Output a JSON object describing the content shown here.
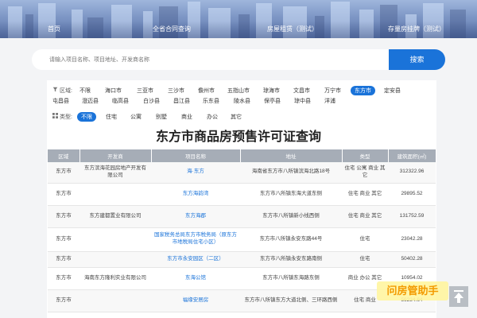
{
  "nav": [
    "首页",
    "全省合同查询",
    "房屋租赁（测试）",
    "存量房挂牌（测试）"
  ],
  "search": {
    "placeholder": "请输入项目名称、项目地址、开发商名称",
    "button": "搜索"
  },
  "filters": {
    "region_label": "区域:",
    "regions": [
      "不限",
      "海口市",
      "三亚市",
      "三沙市",
      "儋州市",
      "五指山市",
      "琼海市",
      "文昌市",
      "万宁市",
      "东方市",
      "定安县",
      "屯昌县",
      "澄迈县",
      "临高县",
      "白沙县",
      "昌江县",
      "乐东县",
      "陵水县",
      "保亭县",
      "琼中县",
      "洋浦"
    ],
    "region_selected": "东方市",
    "type_label": "类型:",
    "types": [
      "不限",
      "住宅",
      "公寓",
      "别墅",
      "商业",
      "办公",
      "其它"
    ],
    "type_selected": "不限"
  },
  "page_title": "东方市商品房预售许可证查询",
  "table": {
    "headers": [
      "区域",
      "开发商",
      "项目名称",
      "地址",
      "类型",
      "建筑面积(㎡)"
    ],
    "rows": [
      [
        "东方市",
        "东方滨海花园房地产开发有限公司",
        "海·东方",
        "海南省东方市八所镇滨海北路18号",
        "住宅 公寓 商业 其它",
        "312322.96"
      ],
      [
        "东方市",
        "",
        "东方海韵湾",
        "东方市八所镇东海大道东侧",
        "住宅 商业 其它",
        "29895.52"
      ],
      [
        "东方市",
        "东方建都置业有限公司",
        "东方海郡",
        "东方市八所镇新小线西侧",
        "住宅 商业 其它",
        "131752.59"
      ],
      [
        "东方市",
        "",
        "国家税务总局东方市税务局（原东方市地税局住宅小区）",
        "东方市八所镇永安东路44号",
        "住宅",
        "23042.28"
      ],
      [
        "东方市",
        "",
        "东方市永安园区（二区）",
        "东方市八所镇永安东路南侧",
        "住宅",
        "50402.28"
      ],
      [
        "东方市",
        "海南东方隆利实业有限公司",
        "东海公馆",
        "东方市八所镇东海路东侧",
        "商业 办公 其它",
        "10954.02"
      ],
      [
        "东方市",
        "",
        "福缘安居房",
        "东方市八所镇东方大道北侧、三环路西侧",
        "住宅 商业",
        "56234.64"
      ]
    ]
  },
  "watermark": "问房管助手",
  "accent_color": "#1a73d9",
  "icons": {
    "back_to_top": "arrow-up-icon"
  }
}
